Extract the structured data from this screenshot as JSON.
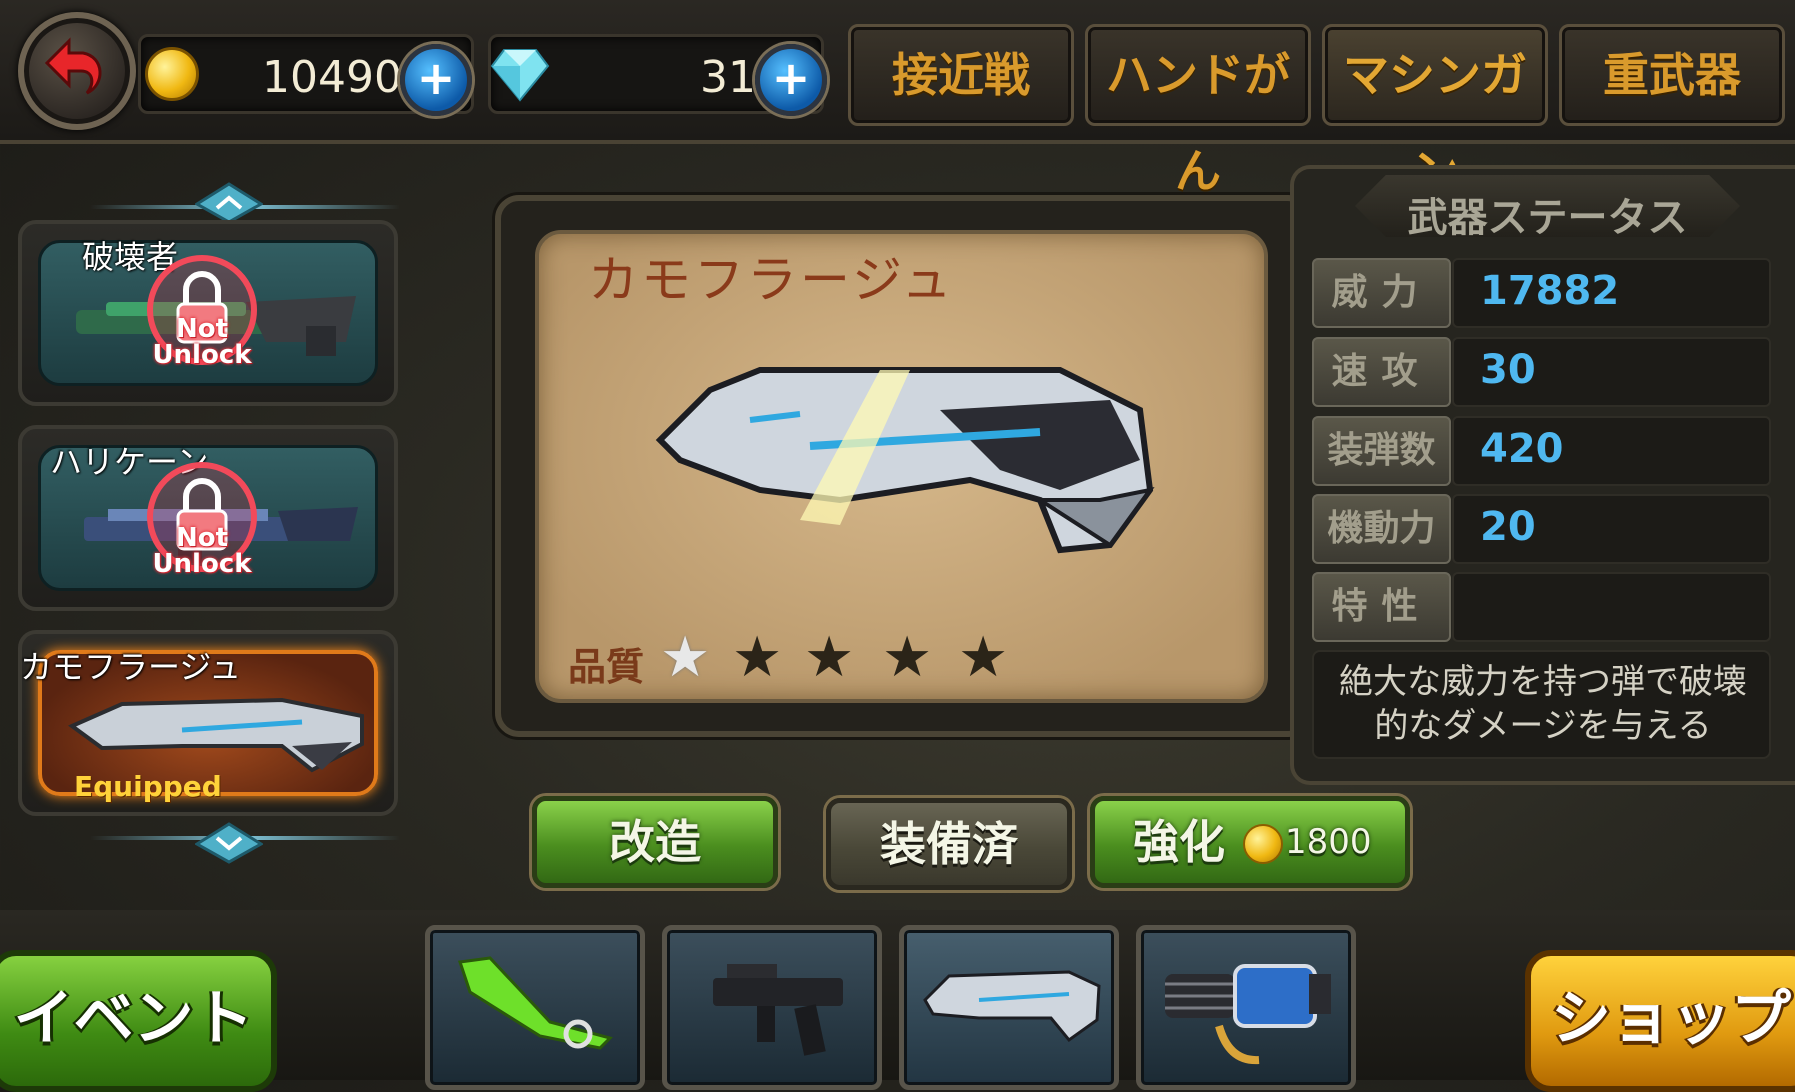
{
  "currency": {
    "coins": "10490",
    "gems": "31"
  },
  "tabs": [
    {
      "label": "接近戦"
    },
    {
      "label": "ハンドがん"
    },
    {
      "label": "マシンガン",
      "active": true
    },
    {
      "label": "重武器"
    }
  ],
  "weapon_list": [
    {
      "name": "破壊者",
      "locked_text": "Not\nUnlock"
    },
    {
      "name": "ハリケーン",
      "locked_text": "Not\nUnlock"
    },
    {
      "name": "カモフラージュ",
      "status": "Equipped"
    }
  ],
  "detail": {
    "title": "カモフラージュ",
    "quality_label": "品質",
    "quality_stars_filled": 1,
    "quality_stars_total": 5
  },
  "stats": {
    "title": "武器ステータス",
    "rows": [
      {
        "label": "威力",
        "value": "17882"
      },
      {
        "label": "速攻",
        "value": "30"
      },
      {
        "label": "装弾数",
        "value": "420"
      },
      {
        "label": "機動力",
        "value": "20"
      },
      {
        "label": "特性",
        "value": ""
      }
    ],
    "description": "絶大な威力を持つ弾で破壊的なダメージを与える"
  },
  "actions": {
    "modify_label": "改造",
    "equipped_label": "装備済",
    "upgrade_label": "強化",
    "upgrade_cost": "1800"
  },
  "bottom": {
    "event_label": "イベント",
    "shop_label": "ショップ"
  },
  "colors": {
    "accent_orange": "#d99a2c",
    "stat_value_blue": "#4fb8f0",
    "button_green": "#4b8e1f"
  }
}
